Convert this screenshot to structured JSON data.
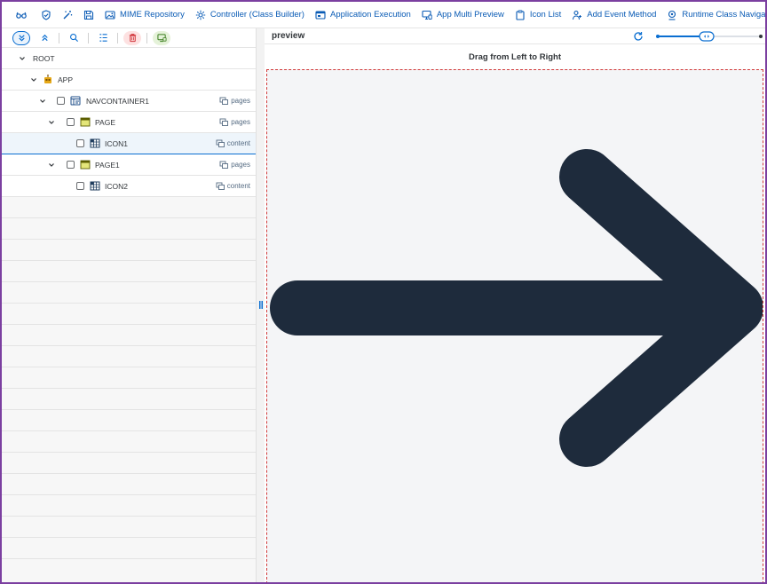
{
  "toolbar": {
    "items": [
      {
        "label": "MIME Repository",
        "icon": "image-icon"
      },
      {
        "label": "Controller (Class Builder)",
        "icon": "gear-icon"
      },
      {
        "label": "Application Execution",
        "icon": "application-icon"
      },
      {
        "label": "App Multi Preview",
        "icon": "monitor-icon"
      },
      {
        "label": "Icon List",
        "icon": "clipboard-icon"
      },
      {
        "label": "Add Event Method",
        "icon": "add-person-icon"
      },
      {
        "label": "Runtime Class Navigator",
        "icon": "navigator-icon"
      }
    ]
  },
  "tree": {
    "rows": [
      {
        "label": "ROOT",
        "aggregation": ""
      },
      {
        "label": "APP",
        "aggregation": ""
      },
      {
        "label": "NAVCONTAINER1",
        "aggregation": "pages"
      },
      {
        "label": "PAGE",
        "aggregation": "pages"
      },
      {
        "label": "ICON1",
        "aggregation": "content"
      },
      {
        "label": "PAGE1",
        "aggregation": "pages"
      },
      {
        "label": "ICON2",
        "aggregation": "content"
      }
    ]
  },
  "preview": {
    "header": "preview",
    "title": "Drag from Left to Right"
  },
  "colors": {
    "accent": "#0a6ed1",
    "link": "#0a5bb5",
    "frame": "#7b3fa0",
    "arrow": "#1e2b3c",
    "dashed_border": "#d13a3a"
  }
}
